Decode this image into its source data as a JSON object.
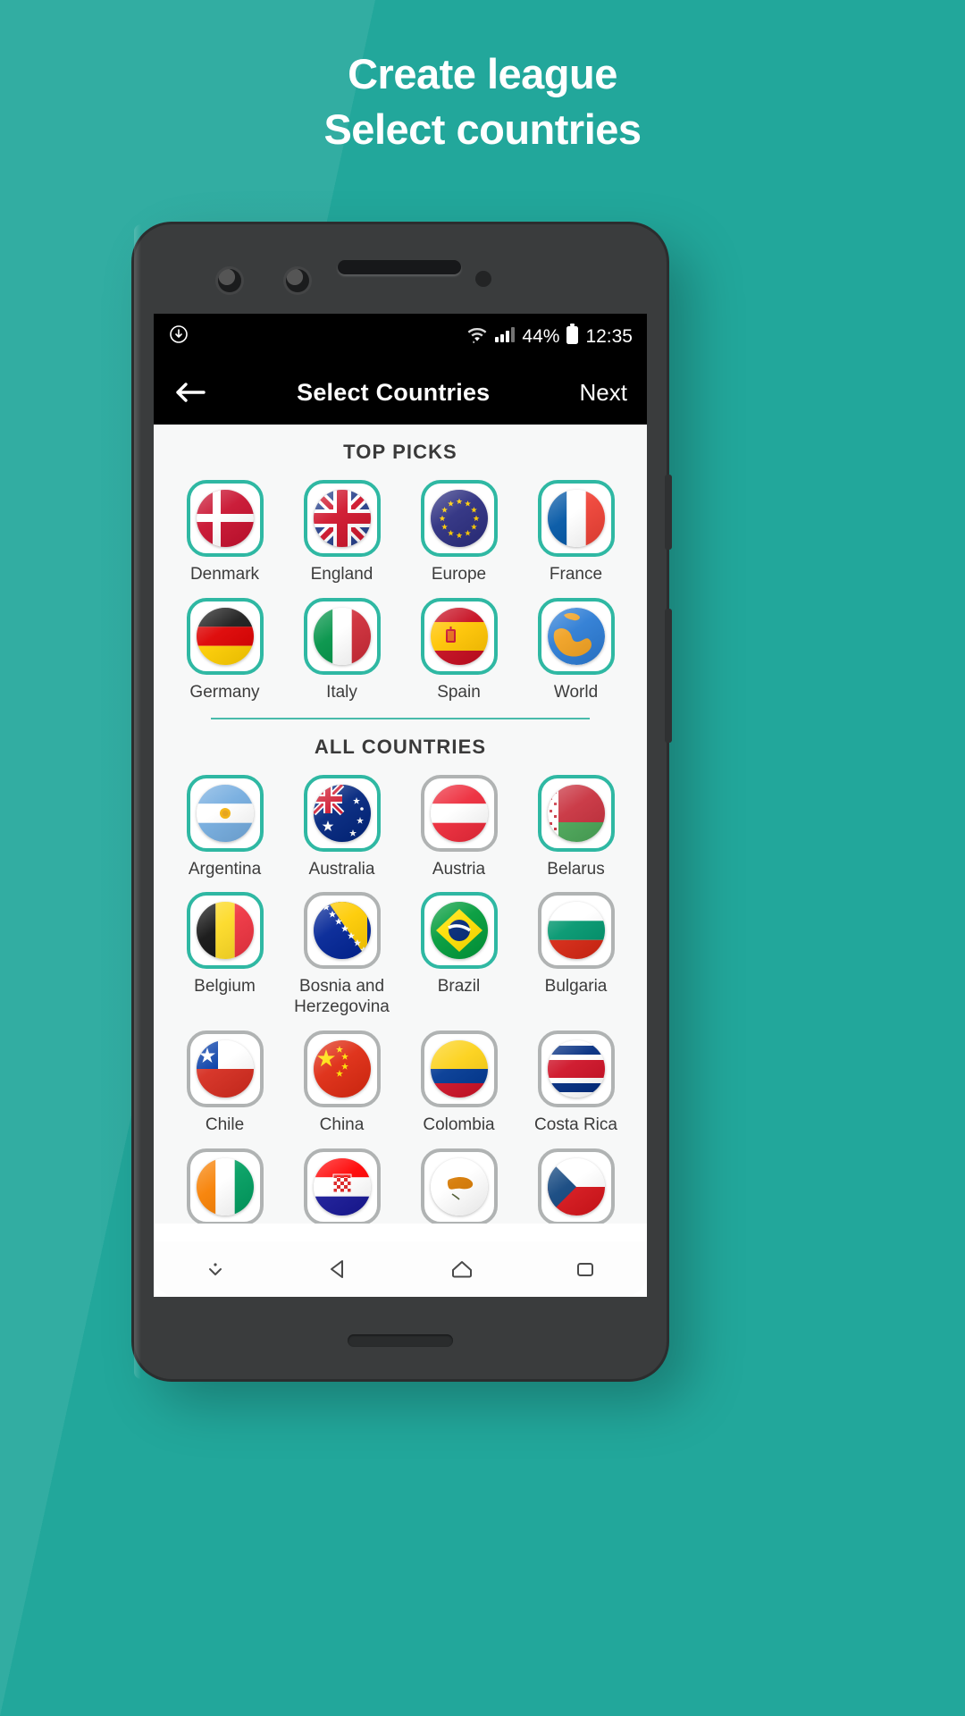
{
  "promo": {
    "line1": "Create league",
    "line2": "Select countries"
  },
  "colors": {
    "brand_background": "#22a79b",
    "accent_selected": "#2fb8a3",
    "tile_border_unselected": "#b0b3b3",
    "appbar_background": "#000000",
    "content_background": "#f7f8f8"
  },
  "statusbar": {
    "download_icon": "download-circle-icon",
    "wifi_icon": "wifi-icon",
    "signal_icon": "signal-bars-icon",
    "battery_percent": "44%",
    "battery_icon": "battery-icon",
    "time": "12:35"
  },
  "appbar": {
    "back_icon": "back-arrow-icon",
    "title": "Select Countries",
    "next_label": "Next"
  },
  "sections": [
    {
      "id": "top-picks",
      "title": "TOP PICKS",
      "items": [
        {
          "name": "Denmark",
          "selected": true,
          "flag": "denmark"
        },
        {
          "name": "England",
          "selected": true,
          "flag": "england"
        },
        {
          "name": "Europe",
          "selected": true,
          "flag": "europe"
        },
        {
          "name": "France",
          "selected": true,
          "flag": "france"
        },
        {
          "name": "Germany",
          "selected": true,
          "flag": "germany"
        },
        {
          "name": "Italy",
          "selected": true,
          "flag": "italy"
        },
        {
          "name": "Spain",
          "selected": true,
          "flag": "spain"
        },
        {
          "name": "World",
          "selected": true,
          "flag": "world"
        }
      ]
    },
    {
      "id": "all-countries",
      "title": "ALL COUNTRIES",
      "items": [
        {
          "name": "Argentina",
          "selected": true,
          "flag": "argentina"
        },
        {
          "name": "Australia",
          "selected": true,
          "flag": "australia"
        },
        {
          "name": "Austria",
          "selected": false,
          "flag": "austria"
        },
        {
          "name": "Belarus",
          "selected": true,
          "flag": "belarus"
        },
        {
          "name": "Belgium",
          "selected": true,
          "flag": "belgium"
        },
        {
          "name": "Bosnia and Herzegovina",
          "selected": false,
          "flag": "bosnia"
        },
        {
          "name": "Brazil",
          "selected": true,
          "flag": "brazil"
        },
        {
          "name": "Bulgaria",
          "selected": false,
          "flag": "bulgaria"
        },
        {
          "name": "Chile",
          "selected": false,
          "flag": "chile"
        },
        {
          "name": "China",
          "selected": false,
          "flag": "china"
        },
        {
          "name": "Colombia",
          "selected": false,
          "flag": "colombia"
        },
        {
          "name": "Costa Rica",
          "selected": false,
          "flag": "costarica"
        },
        {
          "name": "",
          "selected": false,
          "flag": "ivorycoast"
        },
        {
          "name": "",
          "selected": false,
          "flag": "croatia"
        },
        {
          "name": "",
          "selected": false,
          "flag": "cyprus"
        },
        {
          "name": "",
          "selected": false,
          "flag": "czech"
        }
      ]
    }
  ],
  "navbar": {
    "items": [
      {
        "icon": "chevron-down-icon"
      },
      {
        "icon": "back-triangle-icon"
      },
      {
        "icon": "home-icon"
      },
      {
        "icon": "recents-square-icon"
      }
    ]
  }
}
